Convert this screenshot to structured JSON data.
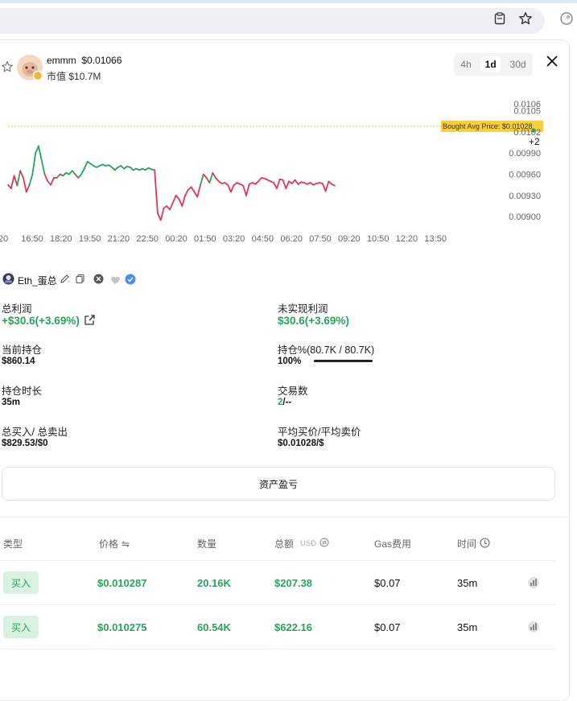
{
  "token": {
    "name": "emmm",
    "price": "$0.01066",
    "market_cap_label": "市值",
    "market_cap": "$10.7M"
  },
  "timeframes": [
    {
      "label": "4h",
      "active": false
    },
    {
      "label": "1d",
      "active": true
    },
    {
      "label": "30d",
      "active": false
    }
  ],
  "chart_data": {
    "type": "line",
    "title": "",
    "x_ticks": [
      "20",
      "16:50",
      "18:20",
      "19:50",
      "21:20",
      "22:50",
      "00:20",
      "01:50",
      "03:20",
      "04:50",
      "06:20",
      "07:50",
      "09:20",
      "10:50",
      "12:20",
      "13:50"
    ],
    "y_ticks": [
      "0.0106",
      "0.0105",
      "0.0102",
      "0.00990",
      "0.00960",
      "0.00930",
      "0.00900"
    ],
    "ylim": [
      0.0089,
      0.0107
    ],
    "avg_price_line": {
      "label": "Bought Avg Price: $0.01028",
      "value": 0.01028
    },
    "marker_label": "+2",
    "colors": {
      "up": "#27a35a",
      "down": "#e0365b",
      "avg_line": "#d8c23c",
      "avg_label_bg": "#f7cf3e"
    },
    "series": [
      {
        "values": [
          0.00945,
          0.0094,
          0.00958,
          0.00944,
          0.00965,
          0.00955,
          0.00935,
          0.00945,
          0.0096,
          0.0099,
          0.01,
          0.0098,
          0.0096,
          0.0095,
          0.00945,
          0.00955,
          0.00955,
          0.0096,
          0.00958,
          0.00962,
          0.0096,
          0.00965,
          0.0096,
          0.00955,
          0.0096,
          0.00968,
          0.00978,
          0.00975,
          0.00972,
          0.0097,
          0.00972,
          0.00974,
          0.00972,
          0.00973,
          0.0097,
          0.00966,
          0.0097,
          0.00972,
          0.00968,
          0.00971,
          0.0097,
          0.00966,
          0.00968,
          0.00966,
          0.00968,
          0.00966,
          0.00969,
          0.00967,
          0.00966,
          0.00905,
          0.00895,
          0.00912,
          0.00915,
          0.0091,
          0.0092,
          0.0093,
          0.00925,
          0.00915,
          0.0093,
          0.00938,
          0.00942,
          0.00935,
          0.00928,
          0.00945,
          0.0096,
          0.00955,
          0.00948,
          0.00962,
          0.00955,
          0.0095,
          0.00947,
          0.00948,
          0.00945,
          0.00935,
          0.00945,
          0.00948,
          0.00946,
          0.00944,
          0.0093,
          0.00946,
          0.00948,
          0.00946,
          0.0095,
          0.00955,
          0.00954,
          0.00952,
          0.0095,
          0.00948,
          0.0094,
          0.00953,
          0.00952,
          0.0094,
          0.0095,
          0.00947,
          0.00952,
          0.00946,
          0.00949,
          0.00948,
          0.00946,
          0.00948,
          0.00945,
          0.00947,
          0.00948,
          0.00947,
          0.00936,
          0.0095,
          0.00946,
          0.00944
        ]
      }
    ]
  },
  "owner": {
    "name": "Eth_蛋总"
  },
  "stats": {
    "total_profit_label": "总利润",
    "total_profit_value": "+$30.6(+3.69%)",
    "unrealized_label": "未实现利润",
    "unrealized_value": "$30.6(+3.69%)",
    "holding_label": "当前持仓",
    "holding_value": "$860.14",
    "holding_pct_label": "持仓%(80.7K / 80.7K)",
    "holding_pct_value": "100%",
    "holding_pct": 1.0,
    "duration_label": "持仓时长",
    "duration_value": "35m",
    "tx_count_label": "交易数",
    "tx_buys": "2",
    "tx_sells": "/--",
    "total_buy_sell_label": "总买入/ 总卖出",
    "total_buy_sell_value": "$829.53/$0",
    "avg_price_label": "平均买价/平均卖价",
    "avg_price_value": "$0.01028/$"
  },
  "asset_button": "资产盈亏",
  "table": {
    "headers": {
      "type": "类型",
      "price": "价格",
      "price_icon": "⇋",
      "amount": "数量",
      "total": "总额",
      "total_unit": "USD",
      "gas": "Gas费用",
      "time": "时间"
    },
    "rows": [
      {
        "type": "买入",
        "price": "$0.010287",
        "amount": "20.16K",
        "total": "$207.38",
        "gas": "$0.07",
        "time": "35m"
      },
      {
        "type": "买入",
        "price": "$0.010275",
        "amount": "60.54K",
        "total": "$622.16",
        "gas": "$0.07",
        "time": "35m"
      }
    ]
  }
}
